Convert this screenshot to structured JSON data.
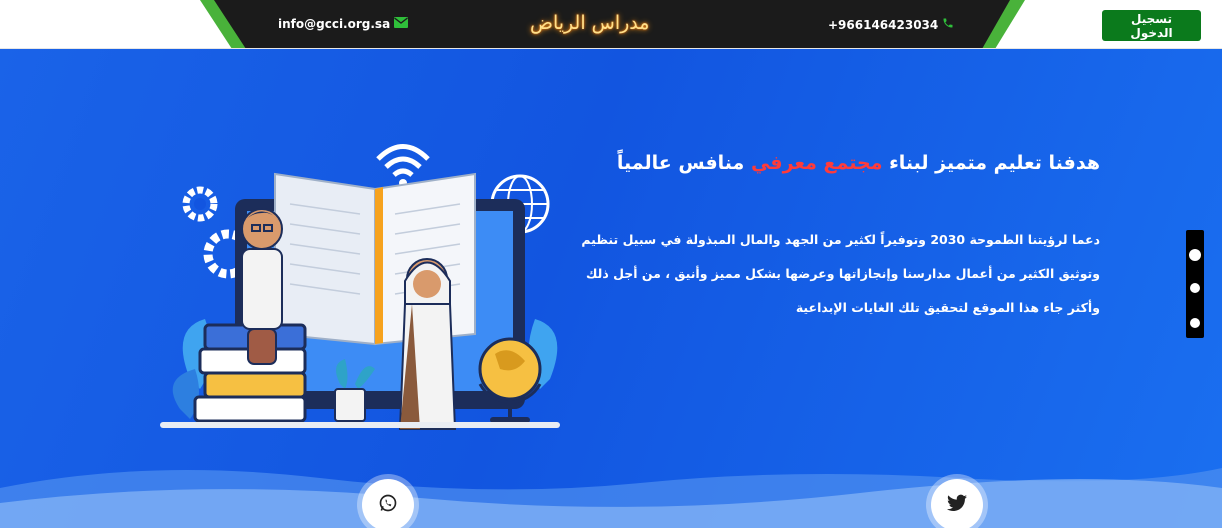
{
  "header": {
    "login_label": "تسجيل الدخول",
    "phone": "+966146423034",
    "email": "info@gcci.org.sa",
    "site_title": "مدراس الرياض"
  },
  "hero": {
    "headline_part1": "هدفنا تعليم متميز لبناء ",
    "headline_accent": "مجتمع معرفي",
    "headline_part2": " منافس عالمياً",
    "paragraph_lines": [
      "دعما لرؤيتنا الطموحة 2030 وتوفيراً لكثير من الجهد والمال المبذولة في سبيل تنظيم",
      "وتوثيق الكثير من أعمال مدارسنا وإنجازاتها وعرضها بشكل مميز وأنيق ، من أجل ذلك",
      "وأكثر جاء هذا الموقع لتحقيق تلك الغايات الإبداعية"
    ]
  },
  "colors": {
    "brand_green": "#0b7a1c",
    "hero_blue": "#1255e0",
    "accent_red": "#ff3b3b",
    "title_glow": "#ff9f1c"
  },
  "icons": {
    "phone": "phone-icon",
    "email": "envelope-icon",
    "whatsapp": "whatsapp-icon",
    "twitter": "twitter-icon"
  }
}
